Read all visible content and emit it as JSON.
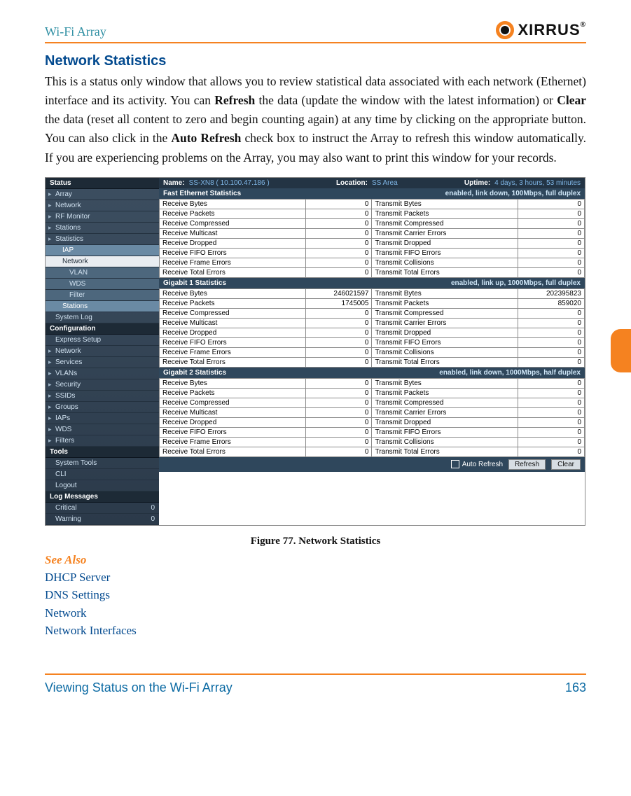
{
  "header": {
    "running_head": "Wi-Fi Array",
    "logo_text": "XIRRUS"
  },
  "section_title": "Network Statistics",
  "body_paragraph": "This is a status only window that allows you to review statistical data associated with each network (Ethernet) interface and its activity. You can Refresh the data (update the window with the latest information) or Clear the data (reset all content to zero and begin counting again) at any time by clicking on the appropriate button. You can also click in the Auto Refresh check box to instruct the Array to refresh this window automatically. If you are experiencing problems on the Array, you may also want to print this window for your records.",
  "figure_caption": "Figure 77. Network Statistics",
  "see_also_heading": "See Also",
  "see_also_links": [
    "DHCP Server",
    "DNS Settings",
    "Network",
    "Network Interfaces"
  ],
  "footer": {
    "left": "Viewing Status on the Wi-Fi Array",
    "right": "163"
  },
  "shot": {
    "nav": {
      "groups": [
        {
          "head": "Status",
          "items": [
            {
              "label": "Array"
            },
            {
              "label": "Network"
            },
            {
              "label": "RF Monitor"
            },
            {
              "label": "Stations"
            },
            {
              "label": "Statistics"
            },
            {
              "label": "IAP",
              "cls": "sub sel noarrow"
            },
            {
              "label": "Network",
              "cls": "sub light noarrow"
            },
            {
              "label": "VLAN",
              "cls": "sub2 noarrow"
            },
            {
              "label": "WDS",
              "cls": "sub2 noarrow"
            },
            {
              "label": "Filter",
              "cls": "sub2 noarrow"
            },
            {
              "label": "Stations",
              "cls": "sub sel noarrow"
            },
            {
              "label": "System Log",
              "cls": "noarrow"
            }
          ]
        },
        {
          "head": "Configuration",
          "items": [
            {
              "label": "Express Setup",
              "cls": "noarrow"
            },
            {
              "label": "Network"
            },
            {
              "label": "Services"
            },
            {
              "label": "VLANs"
            },
            {
              "label": "Security"
            },
            {
              "label": "SSIDs"
            },
            {
              "label": "Groups"
            },
            {
              "label": "IAPs"
            },
            {
              "label": "WDS"
            },
            {
              "label": "Filters"
            }
          ]
        },
        {
          "head": "Tools",
          "items": [
            {
              "label": "System Tools",
              "cls": "noarrow"
            },
            {
              "label": "CLI",
              "cls": "noarrow"
            },
            {
              "label": "Logout",
              "cls": "noarrow"
            }
          ]
        },
        {
          "head": "Log Messages",
          "items": [
            {
              "label": "Critical",
              "count": "0",
              "cls": "noarrow count"
            },
            {
              "label": "Warning",
              "count": "0",
              "cls": "noarrow count"
            }
          ]
        }
      ]
    },
    "topbar": {
      "name_k": "Name:",
      "name_v": "SS-XN8   ( 10.100.47.186 )",
      "loc_k": "Location:",
      "loc_v": "SS Area",
      "up_k": "Uptime:",
      "up_v": "4 days, 3 hours, 53 minutes"
    },
    "sections": [
      {
        "title": "Fast Ethernet Statistics",
        "status": "enabled, link down, 100Mbps, full duplex",
        "rows": [
          [
            "Receive Bytes",
            "0",
            "Transmit Bytes",
            "0"
          ],
          [
            "Receive Packets",
            "0",
            "Transmit Packets",
            "0"
          ],
          [
            "Receive Compressed",
            "0",
            "Transmit Compressed",
            "0"
          ],
          [
            "Receive Multicast",
            "0",
            "Transmit Carrier Errors",
            "0"
          ],
          [
            "Receive Dropped",
            "0",
            "Transmit Dropped",
            "0"
          ],
          [
            "Receive FIFO Errors",
            "0",
            "Transmit FIFO Errors",
            "0"
          ],
          [
            "Receive Frame Errors",
            "0",
            "Transmit Collisions",
            "0"
          ],
          [
            "Receive Total Errors",
            "0",
            "Transmit Total Errors",
            "0"
          ]
        ]
      },
      {
        "title": "Gigabit 1 Statistics",
        "status": "enabled, link up, 1000Mbps, full duplex",
        "rows": [
          [
            "Receive Bytes",
            "246021597",
            "Transmit Bytes",
            "202395823"
          ],
          [
            "Receive Packets",
            "1745005",
            "Transmit Packets",
            "859020"
          ],
          [
            "Receive Compressed",
            "0",
            "Transmit Compressed",
            "0"
          ],
          [
            "Receive Multicast",
            "0",
            "Transmit Carrier Errors",
            "0"
          ],
          [
            "Receive Dropped",
            "0",
            "Transmit Dropped",
            "0"
          ],
          [
            "Receive FIFO Errors",
            "0",
            "Transmit FIFO Errors",
            "0"
          ],
          [
            "Receive Frame Errors",
            "0",
            "Transmit Collisions",
            "0"
          ],
          [
            "Receive Total Errors",
            "0",
            "Transmit Total Errors",
            "0"
          ]
        ]
      },
      {
        "title": "Gigabit 2 Statistics",
        "status": "enabled, link down, 1000Mbps, half duplex",
        "rows": [
          [
            "Receive Bytes",
            "0",
            "Transmit Bytes",
            "0"
          ],
          [
            "Receive Packets",
            "0",
            "Transmit Packets",
            "0"
          ],
          [
            "Receive Compressed",
            "0",
            "Transmit Compressed",
            "0"
          ],
          [
            "Receive Multicast",
            "0",
            "Transmit Carrier Errors",
            "0"
          ],
          [
            "Receive Dropped",
            "0",
            "Transmit Dropped",
            "0"
          ],
          [
            "Receive FIFO Errors",
            "0",
            "Transmit FIFO Errors",
            "0"
          ],
          [
            "Receive Frame Errors",
            "0",
            "Transmit Collisions",
            "0"
          ],
          [
            "Receive Total Errors",
            "0",
            "Transmit Total Errors",
            "0"
          ]
        ]
      }
    ],
    "bottom": {
      "auto": "Auto Refresh",
      "refresh": "Refresh",
      "clear": "Clear"
    }
  }
}
